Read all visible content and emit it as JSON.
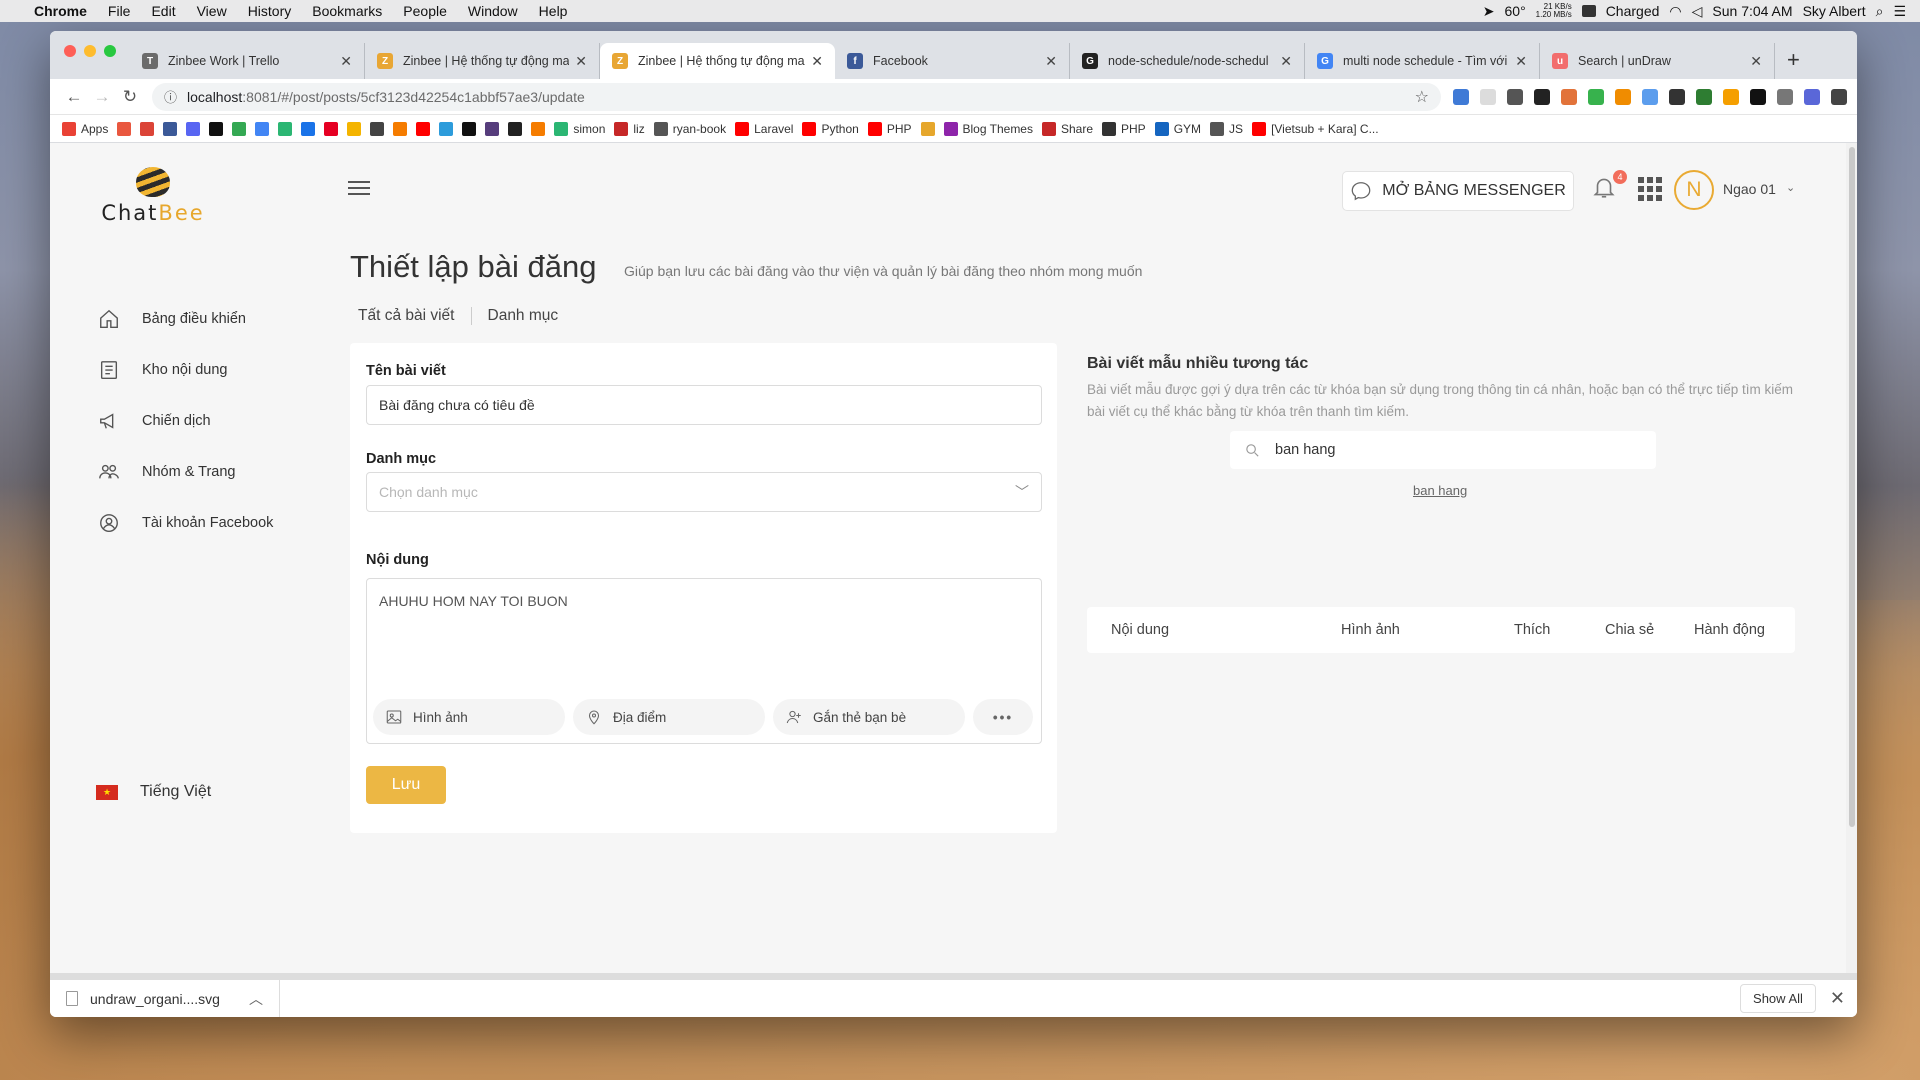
{
  "menubar": {
    "app": "Chrome",
    "items": [
      "File",
      "Edit",
      "View",
      "History",
      "Bookmarks",
      "People",
      "Window",
      "Help"
    ],
    "weather": "60°",
    "net_up": "21 KB/s",
    "net_down": "1.20 MB/s",
    "battery": "Charged",
    "clock": "Sun 7:04 AM",
    "user": "Sky Albert"
  },
  "tabs": [
    {
      "title": "Zinbee Work | Trello",
      "color": "#6b6b6b",
      "glyph": "T"
    },
    {
      "title": "Zinbee | Hệ thống tự động ma",
      "color": "#e8a634",
      "glyph": "Z"
    },
    {
      "title": "Zinbee | Hệ thống tự động ma",
      "color": "#e8a634",
      "glyph": "Z",
      "active": true
    },
    {
      "title": "Facebook",
      "color": "#3b5998",
      "glyph": "f"
    },
    {
      "title": "node-schedule/node-schedul",
      "color": "#222222",
      "glyph": "G"
    },
    {
      "title": "multi node schedule - Tìm với",
      "color": "#4285f4",
      "glyph": "G"
    },
    {
      "title": "Search | unDraw",
      "color": "#f26d6d",
      "glyph": "u"
    }
  ],
  "address": {
    "host": "localhost",
    "path": ":8081/#/post/posts/5cf3123d42254c1abbf57ae3/update"
  },
  "bookmarks": [
    {
      "label": "Apps",
      "color": "#e94235"
    },
    {
      "label": "",
      "color": "#e9573f"
    },
    {
      "label": "",
      "color": "#db4437"
    },
    {
      "label": "",
      "color": "#3b5998"
    },
    {
      "label": "",
      "color": "#5865f2"
    },
    {
      "label": "",
      "color": "#111111"
    },
    {
      "label": "",
      "color": "#34a853"
    },
    {
      "label": "",
      "color": "#4285f4"
    },
    {
      "label": "",
      "color": "#2bb673"
    },
    {
      "label": "",
      "color": "#1a73e8"
    },
    {
      "label": "",
      "color": "#e60023"
    },
    {
      "label": "",
      "color": "#f4b400"
    },
    {
      "label": "",
      "color": "#444444"
    },
    {
      "label": "",
      "color": "#f57c00"
    },
    {
      "label": "",
      "color": "#ff0000"
    },
    {
      "label": "",
      "color": "#2d9cdb"
    },
    {
      "label": "",
      "color": "#111111"
    },
    {
      "label": "",
      "color": "#563d7c"
    },
    {
      "label": "",
      "color": "#222222"
    },
    {
      "label": "",
      "color": "#f57c00"
    },
    {
      "label": "simon",
      "color": "#2bb673"
    },
    {
      "label": "liz",
      "color": "#c62828"
    },
    {
      "label": "ryan-book",
      "color": "#555555"
    },
    {
      "label": "Laravel",
      "color": "#ff0000"
    },
    {
      "label": "Python",
      "color": "#ff0000"
    },
    {
      "label": "PHP",
      "color": "#ff0000"
    },
    {
      "label": "",
      "color": "#e6a72c"
    },
    {
      "label": "Blog Themes",
      "color": "#8e24aa"
    },
    {
      "label": "Share",
      "color": "#c62828"
    },
    {
      "label": "PHP",
      "color": "#333333"
    },
    {
      "label": "GYM",
      "color": "#1565c0"
    },
    {
      "label": "JS",
      "color": "#555555"
    },
    {
      "label": "[Vietsub + Kara] C...",
      "color": "#ff0000"
    }
  ],
  "brand": {
    "name_left": "Chat",
    "name_right": "Bee"
  },
  "sidebar": {
    "items": [
      {
        "label": "Bảng điều khiển",
        "icon": "home-icon"
      },
      {
        "label": "Kho nội dung",
        "icon": "content-icon"
      },
      {
        "label": "Chiến dịch",
        "icon": "megaphone-icon"
      },
      {
        "label": "Nhóm & Trang",
        "icon": "group-icon"
      },
      {
        "label": "Tài khoản Facebook",
        "icon": "account-icon"
      }
    ],
    "language": "Tiếng Việt"
  },
  "header": {
    "messenger_button": "MỞ BẢNG MESSENGER",
    "notification_count": "4",
    "avatar_letter": "N",
    "user_name": "Ngao 01"
  },
  "main": {
    "title": "Thiết lập bài đăng",
    "subtitle": "Giúp bạn lưu các bài đăng vào thư viện và quản lý bài đăng theo nhóm mong muốn",
    "tabs": [
      "Tất cả bài viết",
      "Danh mục"
    ]
  },
  "form": {
    "title_label": "Tên bài viết",
    "title_value": "Bài đăng chưa có tiêu đề",
    "category_label": "Danh mục",
    "category_placeholder": "Chọn danh mục",
    "content_label": "Nội dung",
    "content_value": "AHUHU HOM NAY TOI BUON",
    "actions": [
      "Hình ảnh",
      "Địa điểm",
      "Gắn thẻ bạn bè"
    ],
    "save_label": "Lưu"
  },
  "sample": {
    "title": "Bài viết mẫu nhiều tương tác",
    "description": "Bài viết mẫu được gợi ý dựa trên các từ khóa bạn sử dụng trong thông tin cá nhân, hoặc bạn có thể trực tiếp tìm kiếm bài viết cụ thể khác bằng từ khóa trên thanh tìm kiếm.",
    "search_value": "ban hang",
    "suggestion": "ban hang",
    "columns": [
      "Nội dung",
      "Hình ảnh",
      "Thích",
      "Chia sẻ",
      "Hành động"
    ]
  },
  "downloads": {
    "file": "undraw_organi....svg",
    "show_all": "Show All"
  }
}
